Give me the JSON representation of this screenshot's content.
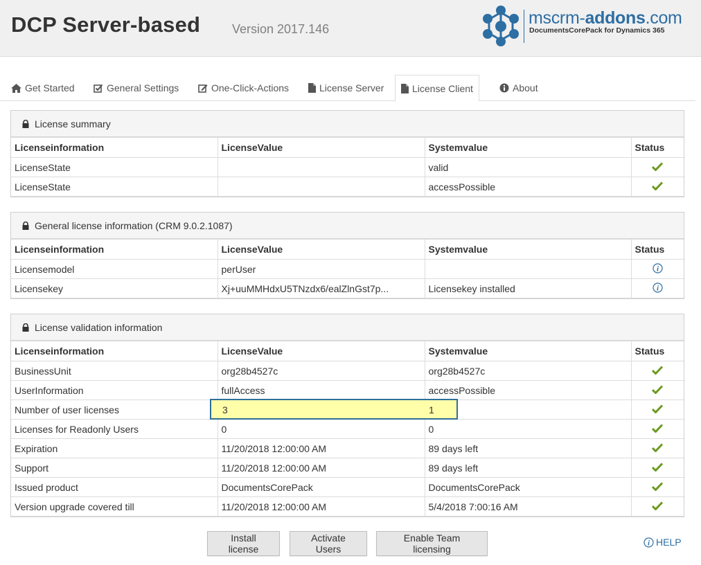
{
  "header": {
    "title": "DCP Server-based",
    "version": "Version 2017.146",
    "logo": {
      "main_prefix": "mscrm-",
      "main_bold": "addons",
      "main_suffix": ".com",
      "sub": "DocumentsCorePack for Dynamics 365"
    }
  },
  "tabs": [
    {
      "label": "Get Started",
      "icon": "home-icon"
    },
    {
      "label": "General Settings",
      "icon": "checkbox-icon"
    },
    {
      "label": "One-Click-Actions",
      "icon": "edit-icon"
    },
    {
      "label": "License Server",
      "icon": "file-icon"
    },
    {
      "label": "License Client",
      "icon": "file-icon",
      "active": true
    },
    {
      "label": "About",
      "icon": "info-circle-icon"
    }
  ],
  "columns": [
    "Licenseinformation",
    "LicenseValue",
    "Systemvalue",
    "Status"
  ],
  "panels": {
    "summary": {
      "title": "License summary",
      "rows": [
        [
          "LicenseState",
          "",
          "valid",
          "check"
        ],
        [
          "LicenseState",
          "",
          "accessPossible",
          "check"
        ]
      ]
    },
    "general": {
      "title": "General license information (CRM 9.0.2.1087)",
      "rows": [
        [
          "Licensemodel",
          "perUser",
          "",
          "info"
        ],
        [
          "Licensekey",
          "Xj+uuMMHdxU5TNzdx6/ealZlnGst7p...",
          "Licensekey installed",
          "info"
        ]
      ]
    },
    "validation": {
      "title": "License validation information",
      "rows": [
        [
          "BusinessUnit",
          "org28b4527c",
          "org28b4527c",
          "check"
        ],
        [
          "UserInformation",
          "fullAccess",
          "accessPossible",
          "check"
        ],
        [
          "Number of user licenses",
          "3",
          "1",
          "check"
        ],
        [
          "Licenses for Readonly Users",
          "0",
          "0",
          "check"
        ],
        [
          "Expiration",
          "11/20/2018 12:00:00 AM",
          "89 days left",
          "check"
        ],
        [
          "Support",
          "11/20/2018 12:00:00 AM",
          "89 days left",
          "check"
        ],
        [
          "Issued product",
          "DocumentsCorePack",
          "DocumentsCorePack",
          "check"
        ],
        [
          "Version upgrade covered till",
          "11/20/2018 12:00:00 AM",
          "5/4/2018 7:00:16 AM",
          "check"
        ]
      ]
    }
  },
  "buttons": {
    "install": "Install license",
    "activate": "Activate Users",
    "team": "Enable Team licensing"
  },
  "help_label": "HELP",
  "colors": {
    "accent": "#2d6ea3",
    "check": "#6a9a1f",
    "highlight": "#ffffaa",
    "highlight_border": "#2f6f97"
  }
}
